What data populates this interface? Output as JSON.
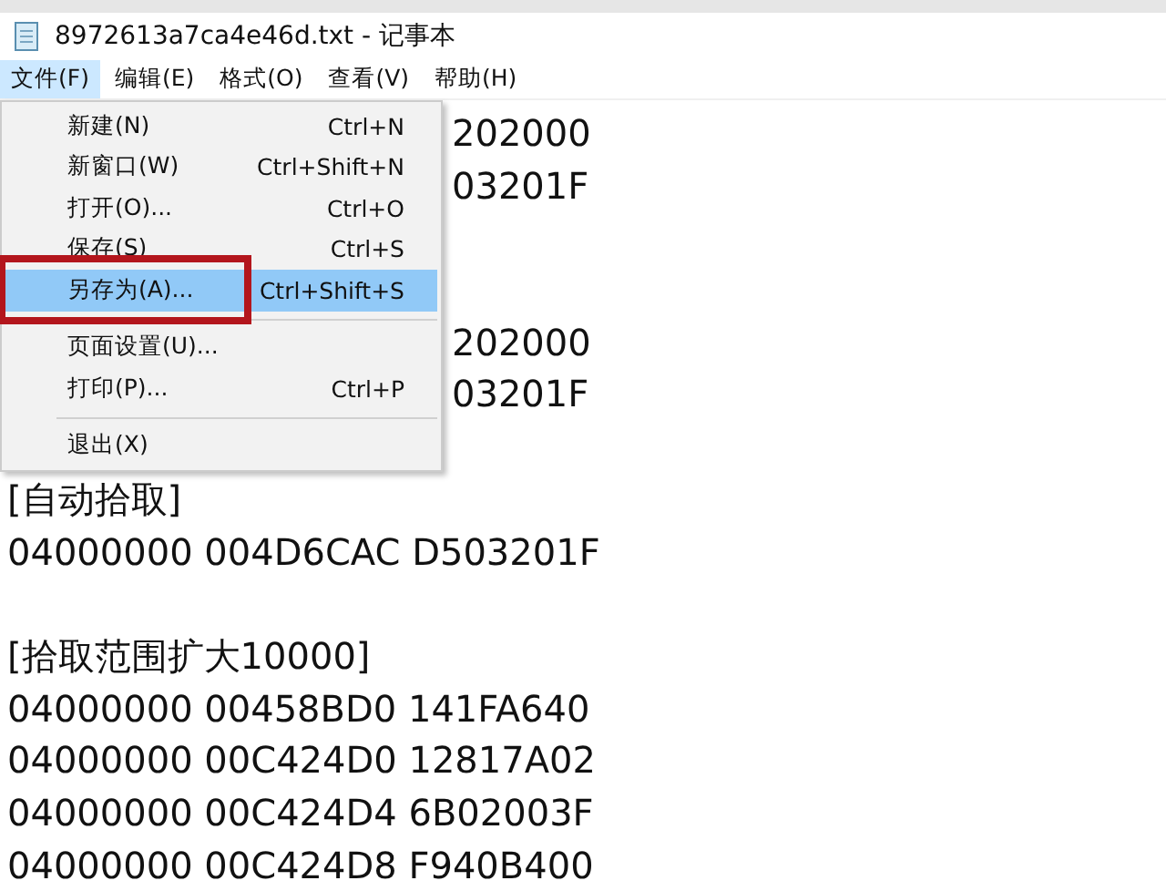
{
  "window": {
    "title": "8972613a7ca4e46d.txt - 记事本"
  },
  "menu_bar": [
    {
      "label": "文件(F)",
      "selected": true
    },
    {
      "label": "编辑(E)",
      "selected": false
    },
    {
      "label": "格式(O)",
      "selected": false
    },
    {
      "label": "查看(V)",
      "selected": false
    },
    {
      "label": "帮助(H)",
      "selected": false
    }
  ],
  "file_menu": [
    {
      "kind": "item",
      "label": "新建(N)",
      "shortcut": "Ctrl+N",
      "selected": false
    },
    {
      "kind": "item",
      "label": "新窗口(W)",
      "shortcut": "Ctrl+Shift+N",
      "selected": false
    },
    {
      "kind": "item",
      "label": "打开(O)...",
      "shortcut": "Ctrl+O",
      "selected": false
    },
    {
      "kind": "item",
      "label": "保存(S)",
      "shortcut": "Ctrl+S",
      "selected": false
    },
    {
      "kind": "item",
      "label": "另存为(A)...",
      "shortcut": "Ctrl+Shift+S",
      "selected": true,
      "highlighted": true
    },
    {
      "kind": "separator"
    },
    {
      "kind": "item",
      "label": "页面设置(U)...",
      "selected": false
    },
    {
      "kind": "item",
      "label": "打印(P)...",
      "shortcut": "Ctrl+P",
      "selected": false
    },
    {
      "kind": "separator"
    },
    {
      "kind": "item",
      "label": "退出(X)",
      "selected": false
    }
  ],
  "document": [
    {
      "kind": "partial",
      "text": "202000"
    },
    {
      "kind": "partial",
      "text": "03201F"
    },
    {
      "kind": "gap"
    },
    {
      "kind": "gap"
    },
    {
      "kind": "partial",
      "text": "202000"
    },
    {
      "kind": "partial",
      "text": "03201F"
    },
    {
      "kind": "gap"
    },
    {
      "kind": "line",
      "text": "[自动拾取]"
    },
    {
      "kind": "line",
      "text": "04000000 004D6CAC D503201F"
    },
    {
      "kind": "gap"
    },
    {
      "kind": "line",
      "text": "[拾取范围扩大10000]"
    },
    {
      "kind": "line",
      "text": "04000000 00458BD0 141FA640"
    },
    {
      "kind": "line",
      "text": "04000000 00C424D0 12817A02"
    },
    {
      "kind": "line",
      "text": "04000000 00C424D4 6B02003F"
    },
    {
      "kind": "line",
      "text": "04000000 00C424D8 F940B400"
    }
  ]
}
